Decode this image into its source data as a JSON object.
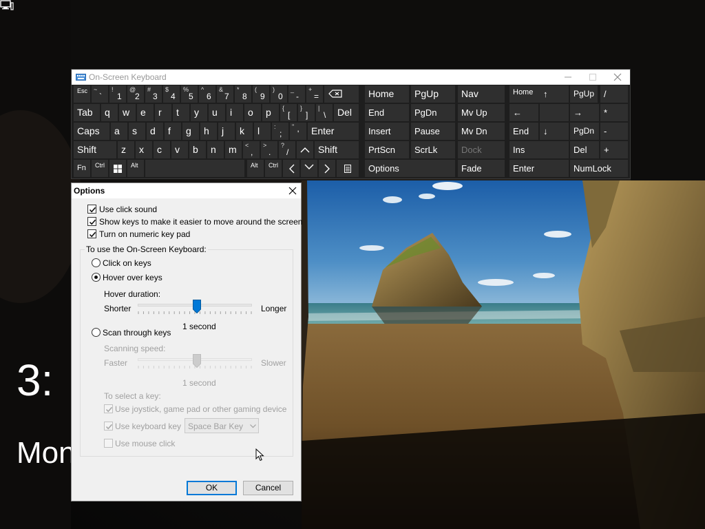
{
  "lockscreen": {
    "time": "3:",
    "date": "Mon"
  },
  "osk": {
    "title": "On-Screen Keyboard",
    "row1": [
      {
        "pri": "Esc",
        "size": "small"
      },
      {
        "sec": "~",
        "pri": "`"
      },
      {
        "sec": "!",
        "pri": "1"
      },
      {
        "sec": "@",
        "pri": "2"
      },
      {
        "sec": "#",
        "pri": "3"
      },
      {
        "sec": "$",
        "pri": "4"
      },
      {
        "sec": "%",
        "pri": "5"
      },
      {
        "sec": "^",
        "pri": "6"
      },
      {
        "sec": "&",
        "pri": "7"
      },
      {
        "sec": "*",
        "pri": "8"
      },
      {
        "sec": "(",
        "pri": "9"
      },
      {
        "sec": ")",
        "pri": "0"
      },
      {
        "sec": "_",
        "pri": "-"
      },
      {
        "sec": "+",
        "pri": "="
      }
    ],
    "row2": [
      "Tab",
      "q",
      "w",
      "e",
      "r",
      "t",
      "y",
      "u",
      "i",
      "o",
      "p"
    ],
    "row2_brackets": [
      {
        "sec": "{",
        "pri": "["
      },
      {
        "sec": "}",
        "pri": "]"
      },
      {
        "sec": "|",
        "pri": "\\"
      }
    ],
    "row2_del": "Del",
    "row3": [
      "Caps",
      "a",
      "s",
      "d",
      "f",
      "g",
      "h",
      "j",
      "k",
      "l"
    ],
    "row3_punct": [
      {
        "sec": ":",
        "pri": ";"
      },
      {
        "sec": "\"",
        "pri": "'"
      }
    ],
    "row3_enter": "Enter",
    "row4": [
      "Shift",
      "z",
      "x",
      "c",
      "v",
      "b",
      "n",
      "m"
    ],
    "row4_punct": [
      {
        "sec": "<",
        "pri": ","
      },
      {
        "sec": ">",
        "pri": "."
      },
      {
        "sec": "?",
        "pri": "/"
      }
    ],
    "row4_shift": "Shift",
    "row5": {
      "fn": "Fn",
      "ctrl": "Ctrl",
      "alt": "Alt",
      "alt_r": "Alt",
      "ctrl_r": "Ctrl"
    },
    "nav": {
      "home": "Home",
      "pgup": "PgUp",
      "nav": "Nav",
      "end": "End",
      "pgdn": "PgDn",
      "mvup": "Mv Up",
      "insert": "Insert",
      "pause": "Pause",
      "mvdn": "Mv Dn",
      "prtscn": "PrtScn",
      "scrlk": "ScrLk",
      "dock": "Dock",
      "options": "Options",
      "fade": "Fade"
    },
    "numpad": {
      "home": "Home",
      "up": "↑",
      "pgup": "PgUp",
      "div": "/",
      "left": "←",
      "right": "→",
      "mul": "*",
      "end": "End",
      "down": "↓",
      "pgdn": "PgDn",
      "minus": "-",
      "ins": "Ins",
      "del": "Del",
      "plus": "+",
      "enter": "Enter",
      "numlock": "NumLock"
    }
  },
  "options": {
    "title": "Options",
    "use_click_sound": "Use click sound",
    "show_keys": "Show keys to make it easier to move around the screen",
    "numeric_keypad": "Turn on numeric key pad",
    "group_label": "To use the On-Screen Keyboard:",
    "click_on_keys": "Click on keys",
    "hover_over_keys": "Hover over keys",
    "hover_duration": "Hover duration:",
    "hover_shorter": "Shorter",
    "hover_longer": "Longer",
    "hover_value": "1 second",
    "hover_fraction": 0.52,
    "scan_through_keys": "Scan through keys",
    "scanning_speed": "Scanning speed:",
    "scan_faster": "Faster",
    "scan_slower": "Slower",
    "scan_value": "1 second",
    "scan_fraction": 0.52,
    "select_key_label": "To select a key:",
    "use_joystick": "Use joystick, game pad or other gaming device",
    "use_keyboard_key": "Use keyboard key",
    "keyboard_key_value": "Space Bar Key",
    "use_mouse_click": "Use mouse click",
    "ok": "OK",
    "cancel": "Cancel"
  }
}
